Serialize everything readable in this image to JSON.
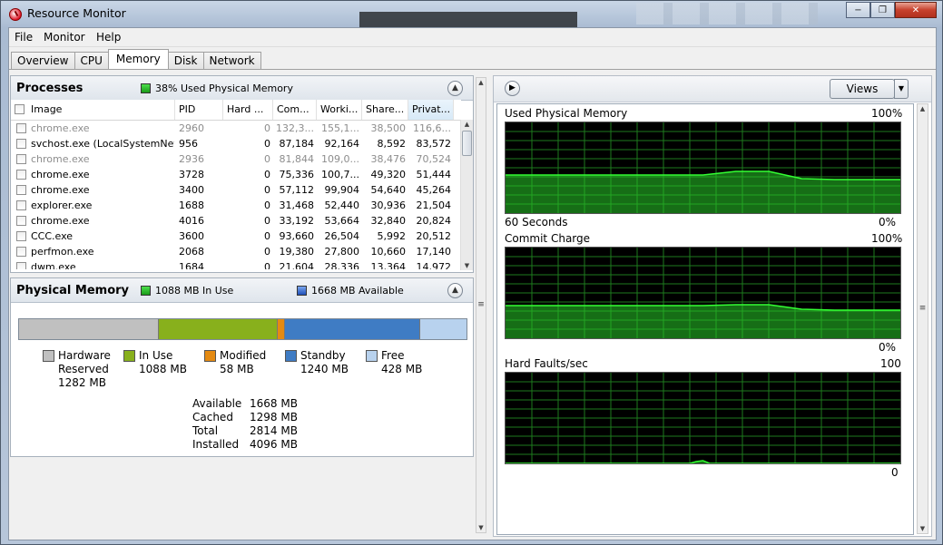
{
  "window": {
    "title": "Resource Monitor"
  },
  "menu": [
    "File",
    "Monitor",
    "Help"
  ],
  "tabs": [
    "Overview",
    "CPU",
    "Memory",
    "Disk",
    "Network"
  ],
  "processes": {
    "title": "Processes",
    "status": "38% Used Physical Memory",
    "columns": [
      "Image",
      "PID",
      "Hard ...",
      "Com...",
      "Worki...",
      "Share...",
      "Privat..."
    ],
    "rows": [
      {
        "image": "chrome.exe",
        "pid": "2960",
        "hard": "0",
        "commit": "132,3...",
        "working": "155,1...",
        "shareable": "38,500",
        "private": "116,6...",
        "gray": true
      },
      {
        "image": "svchost.exe (LocalSystemNet...",
        "pid": "956",
        "hard": "0",
        "commit": "87,184",
        "working": "92,164",
        "shareable": "8,592",
        "private": "83,572",
        "gray": false
      },
      {
        "image": "chrome.exe",
        "pid": "2936",
        "hard": "0",
        "commit": "81,844",
        "working": "109,0...",
        "shareable": "38,476",
        "private": "70,524",
        "gray": true
      },
      {
        "image": "chrome.exe",
        "pid": "3728",
        "hard": "0",
        "commit": "75,336",
        "working": "100,7...",
        "shareable": "49,320",
        "private": "51,444",
        "gray": false
      },
      {
        "image": "chrome.exe",
        "pid": "3400",
        "hard": "0",
        "commit": "57,112",
        "working": "99,904",
        "shareable": "54,640",
        "private": "45,264",
        "gray": false
      },
      {
        "image": "explorer.exe",
        "pid": "1688",
        "hard": "0",
        "commit": "31,468",
        "working": "52,440",
        "shareable": "30,936",
        "private": "21,504",
        "gray": false
      },
      {
        "image": "chrome.exe",
        "pid": "4016",
        "hard": "0",
        "commit": "33,192",
        "working": "53,664",
        "shareable": "32,840",
        "private": "20,824",
        "gray": false
      },
      {
        "image": "CCC.exe",
        "pid": "3600",
        "hard": "0",
        "commit": "93,660",
        "working": "26,504",
        "shareable": "5,992",
        "private": "20,512",
        "gray": false
      },
      {
        "image": "perfmon.exe",
        "pid": "2068",
        "hard": "0",
        "commit": "19,380",
        "working": "27,800",
        "shareable": "10,660",
        "private": "17,140",
        "gray": false
      },
      {
        "image": "dwm.exe",
        "pid": "1684",
        "hard": "0",
        "commit": "21,604",
        "working": "28,336",
        "shareable": "13,364",
        "private": "14,972",
        "gray": false
      }
    ]
  },
  "physical_memory": {
    "title": "Physical Memory",
    "in_use_text": "1088 MB In Use",
    "available_text": "1668 MB Available",
    "segments": [
      {
        "name": "Hardware Reserved",
        "mb": 1282,
        "color": "#c0c0c0"
      },
      {
        "name": "In Use",
        "mb": 1088,
        "color": "#88b01c"
      },
      {
        "name": "Modified",
        "mb": 58,
        "color": "#e48a12"
      },
      {
        "name": "Standby",
        "mb": 1240,
        "color": "#3f7cc4"
      },
      {
        "name": "Free",
        "mb": 428,
        "color": "#b8d2ee"
      }
    ],
    "legend": [
      {
        "label": "Hardware",
        "label2": "Reserved",
        "value": "1282 MB"
      },
      {
        "label": "In Use",
        "value": "1088 MB"
      },
      {
        "label": "Modified",
        "value": "58 MB"
      },
      {
        "label": "Standby",
        "value": "1240 MB"
      },
      {
        "label": "Free",
        "value": "428 MB"
      }
    ],
    "stats": [
      {
        "k": "Available",
        "v": "1668 MB"
      },
      {
        "k": "Cached",
        "v": "1298 MB"
      },
      {
        "k": "Total",
        "v": "2814 MB"
      },
      {
        "k": "Installed",
        "v": "4096 MB"
      }
    ]
  },
  "right": {
    "views_label": "Views",
    "graphs": [
      {
        "title": "Used Physical Memory",
        "max": "100%",
        "min": "0%",
        "footer": "60 Seconds"
      },
      {
        "title": "Commit Charge",
        "max": "100%",
        "min": "0%",
        "footer": ""
      },
      {
        "title": "Hard Faults/sec",
        "max": "100",
        "min": "0",
        "footer": ""
      }
    ]
  },
  "chart_data": [
    {
      "type": "area",
      "title": "Used Physical Memory",
      "xlabel": "60 Seconds",
      "ylim": [
        0,
        100
      ],
      "x": [
        0,
        2,
        5,
        10,
        15,
        20,
        25,
        30,
        35,
        40,
        45,
        50,
        55,
        60
      ],
      "values": [
        42,
        42,
        42,
        42,
        42,
        42,
        42,
        42,
        46,
        46,
        38,
        37,
        37,
        37
      ]
    },
    {
      "type": "area",
      "title": "Commit Charge",
      "ylim": [
        0,
        100
      ],
      "x": [
        0,
        2,
        5,
        10,
        15,
        20,
        25,
        30,
        35,
        40,
        45,
        50,
        55,
        60
      ],
      "values": [
        36,
        36,
        36,
        36,
        36,
        36,
        36,
        36,
        37,
        37,
        32,
        31,
        31,
        31
      ]
    },
    {
      "type": "area",
      "title": "Hard Faults/sec",
      "ylim": [
        0,
        100
      ],
      "x": [
        0,
        10,
        20,
        28,
        29,
        30,
        31,
        40,
        50,
        60
      ],
      "values": [
        0,
        0,
        0,
        0,
        2,
        3,
        0,
        0,
        0,
        0
      ]
    }
  ]
}
